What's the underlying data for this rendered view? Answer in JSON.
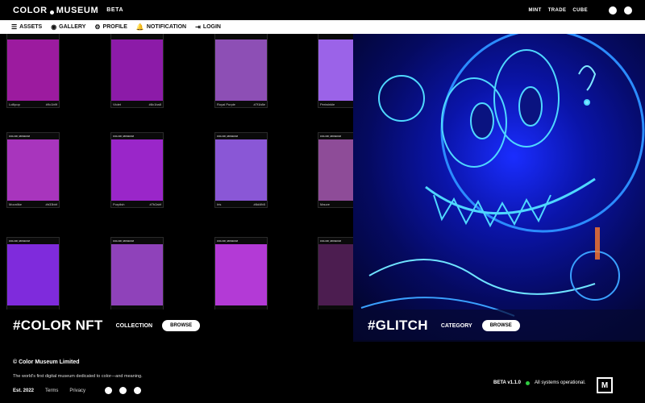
{
  "header": {
    "brand_left": "COLOR",
    "brand_right": "MUSEUM",
    "beta": "BETA",
    "nav": [
      "MINT",
      "TRADE",
      "CUBE"
    ],
    "social_icons": [
      "discord-icon",
      "opensea-icon"
    ]
  },
  "menu": [
    {
      "label": "ASSETS",
      "icon": "☰"
    },
    {
      "label": "GALLERY",
      "icon": "◉"
    },
    {
      "label": "PROFILE",
      "icon": "⚙"
    },
    {
      "label": "NOTIFICATION",
      "icon": "🔔"
    },
    {
      "label": "LOGIN",
      "icon": "⇥"
    }
  ],
  "colors": [
    {
      "name": "Lollipop",
      "hex": "#9c1b9f",
      "code": "#9c1b9f",
      "brand": ""
    },
    {
      "name": "Violet",
      "hex": "#8c1ba8",
      "code": "#8c1ba8",
      "brand": ""
    },
    {
      "name": "Royal Purple",
      "hex": "#8d4fb5",
      "code": "#7f1b8e",
      "brand": ""
    },
    {
      "name": "Periwinkle",
      "hex": "#9b63e8",
      "code": "",
      "brand": ""
    },
    {
      "name": "Moonlike",
      "hex": "#a835bd",
      "code": "#b33bbf",
      "brand": "COLOR_MUSEUM"
    },
    {
      "name": "Purplish",
      "hex": "#9a26c9",
      "code": "#7b2abf",
      "brand": "COLOR_MUSEUM"
    },
    {
      "name": "Iris",
      "hex": "#8a57d6",
      "code": "#8d4fb5",
      "brand": "COLOR_MUSEUM"
    },
    {
      "name": "Mauve",
      "hex": "#8e4c98",
      "code": "",
      "brand": "COLOR_MUSEUM"
    },
    {
      "name": "",
      "hex": "#7f2bdc",
      "code": "",
      "brand": "COLOR_MUSEUM"
    },
    {
      "name": "",
      "hex": "#8f42ba",
      "code": "",
      "brand": "COLOR_MUSEUM"
    },
    {
      "name": "",
      "hex": "#b33ad6",
      "code": "",
      "brand": "COLOR_MUSEUM"
    },
    {
      "name": "",
      "hex": "#4c1d50",
      "code": "",
      "brand": "COLOR_MUSEUM"
    }
  ],
  "banners": {
    "left": {
      "title": "#COLOR NFT",
      "subtitle": "COLLECTION",
      "button": "BROWSE"
    },
    "right": {
      "title": "#GLITCH",
      "subtitle": "CATEGORY",
      "button": "BROWSE"
    }
  },
  "footer": {
    "copyright": "© Color Museum Limited",
    "tagline": "The world's first digital museum dedicated to color—and meaning.",
    "est": "Est. 2022",
    "terms": "Terms",
    "privacy": "Privacy",
    "social_icons": [
      "discord-icon",
      "opensea-icon",
      "instagram-icon"
    ],
    "version": "BETA v1.1.0",
    "status": "All systems operational.",
    "logo": "M"
  },
  "accent": {
    "status": "#2ecc40"
  }
}
